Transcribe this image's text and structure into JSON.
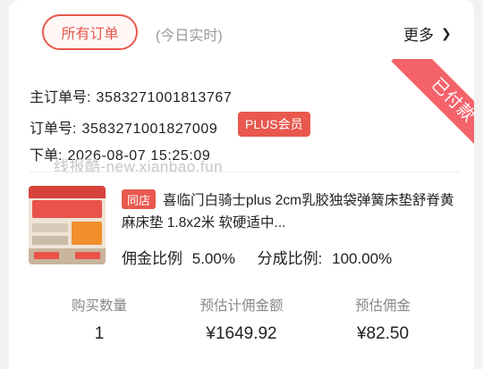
{
  "header": {
    "tab_label": "所有订单",
    "realtime_label": "(今日实时)",
    "more_label": "更多"
  },
  "order": {
    "status_ribbon": "已付款",
    "main_order_label": "主订单号:",
    "main_order_no": "3583271001813767",
    "order_label": "订单号:",
    "order_no": "3583271001827009",
    "member_badge": "PLUS会员",
    "placed_label": "下单:",
    "placed_time": "2026-08-07 15:25:09"
  },
  "watermark": "线报酷-new.xianbao.fun",
  "product": {
    "shop_tag": "同店",
    "title": "喜临门白骑士plus 2cm乳胶独袋弹簧床垫舒脊黄麻床垫 1.8x2米 软硬适中...",
    "commission_rate_label": "佣金比例",
    "commission_rate": "5.00%",
    "share_rate_label": "分成比例:",
    "share_rate": "100.00%"
  },
  "stats": {
    "qty_label": "购买数量",
    "qty": "1",
    "est_base_label": "预估计佣金额",
    "est_base": "¥1649.92",
    "est_comm_label": "预估佣金",
    "est_comm": "¥82.50"
  },
  "colors": {
    "accent": "#e8584e",
    "ribbon": "#f4626a"
  },
  "icons": {
    "more": "chevron-right-icon"
  }
}
